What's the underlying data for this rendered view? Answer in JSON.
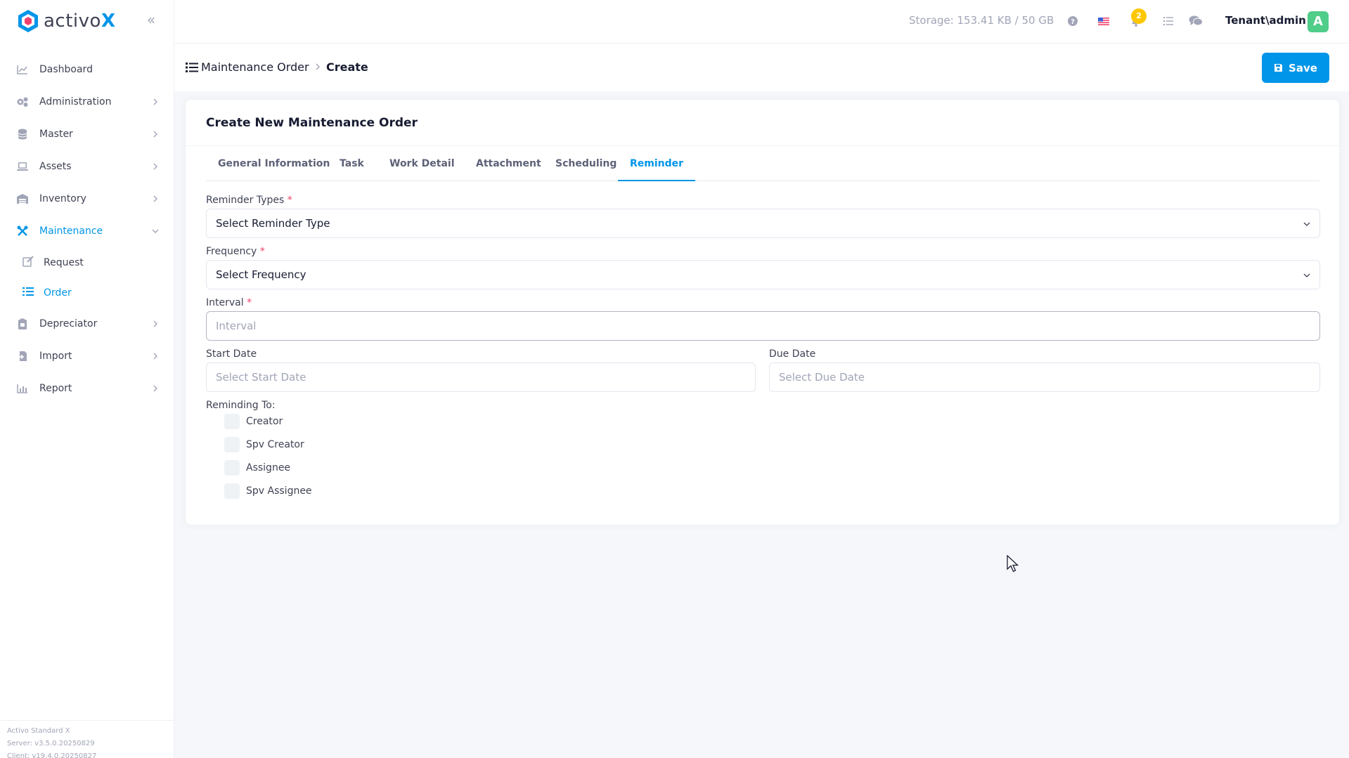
{
  "app": {
    "logo_text_main": "activo",
    "logo_text_accent": "X",
    "brand_color": "#0095e8"
  },
  "sidebar": {
    "items": [
      {
        "label": "Dashboard"
      },
      {
        "label": "Administration"
      },
      {
        "label": "Master"
      },
      {
        "label": "Assets"
      },
      {
        "label": "Inventory"
      },
      {
        "label": "Maintenance"
      },
      {
        "label": "Depreciator"
      },
      {
        "label": "Import"
      },
      {
        "label": "Report"
      }
    ],
    "sub_items": [
      {
        "label": "Request"
      },
      {
        "label": "Order"
      }
    ],
    "footer": {
      "product": "Activo Standard X",
      "server": "Server: v3.5.0.20250829",
      "client": "Client: v19.4.0.20250827"
    }
  },
  "header": {
    "storage": "Storage: 153.41 KB / 50 GB",
    "notification_count": "2",
    "user": "Tenant\\admin",
    "avatar_letter": "A"
  },
  "breadcrumb": {
    "parent": "Maintenance Order",
    "current": "Create"
  },
  "toolbar": {
    "save_label": "Save"
  },
  "card": {
    "title": "Create New Maintenance Order",
    "tabs": [
      {
        "label": "General Information"
      },
      {
        "label": "Task"
      },
      {
        "label": "Work Detail"
      },
      {
        "label": "Attachment"
      },
      {
        "label": "Scheduling"
      },
      {
        "label": "Reminder"
      }
    ]
  },
  "form": {
    "reminder_types": {
      "label": "Reminder Types",
      "value": "Select Reminder Type"
    },
    "frequency": {
      "label": "Frequency",
      "value": "Select Frequency"
    },
    "interval": {
      "label": "Interval",
      "placeholder": "Interval"
    },
    "start_date": {
      "label": "Start Date",
      "placeholder": "Select Start Date"
    },
    "due_date": {
      "label": "Due Date",
      "placeholder": "Select Due Date"
    },
    "reminding_to": {
      "label": "Reminding To:",
      "options": [
        {
          "label": "Creator"
        },
        {
          "label": "Spv Creator"
        },
        {
          "label": "Assignee"
        },
        {
          "label": "Spv Assignee"
        }
      ]
    },
    "required_mark": "*"
  }
}
